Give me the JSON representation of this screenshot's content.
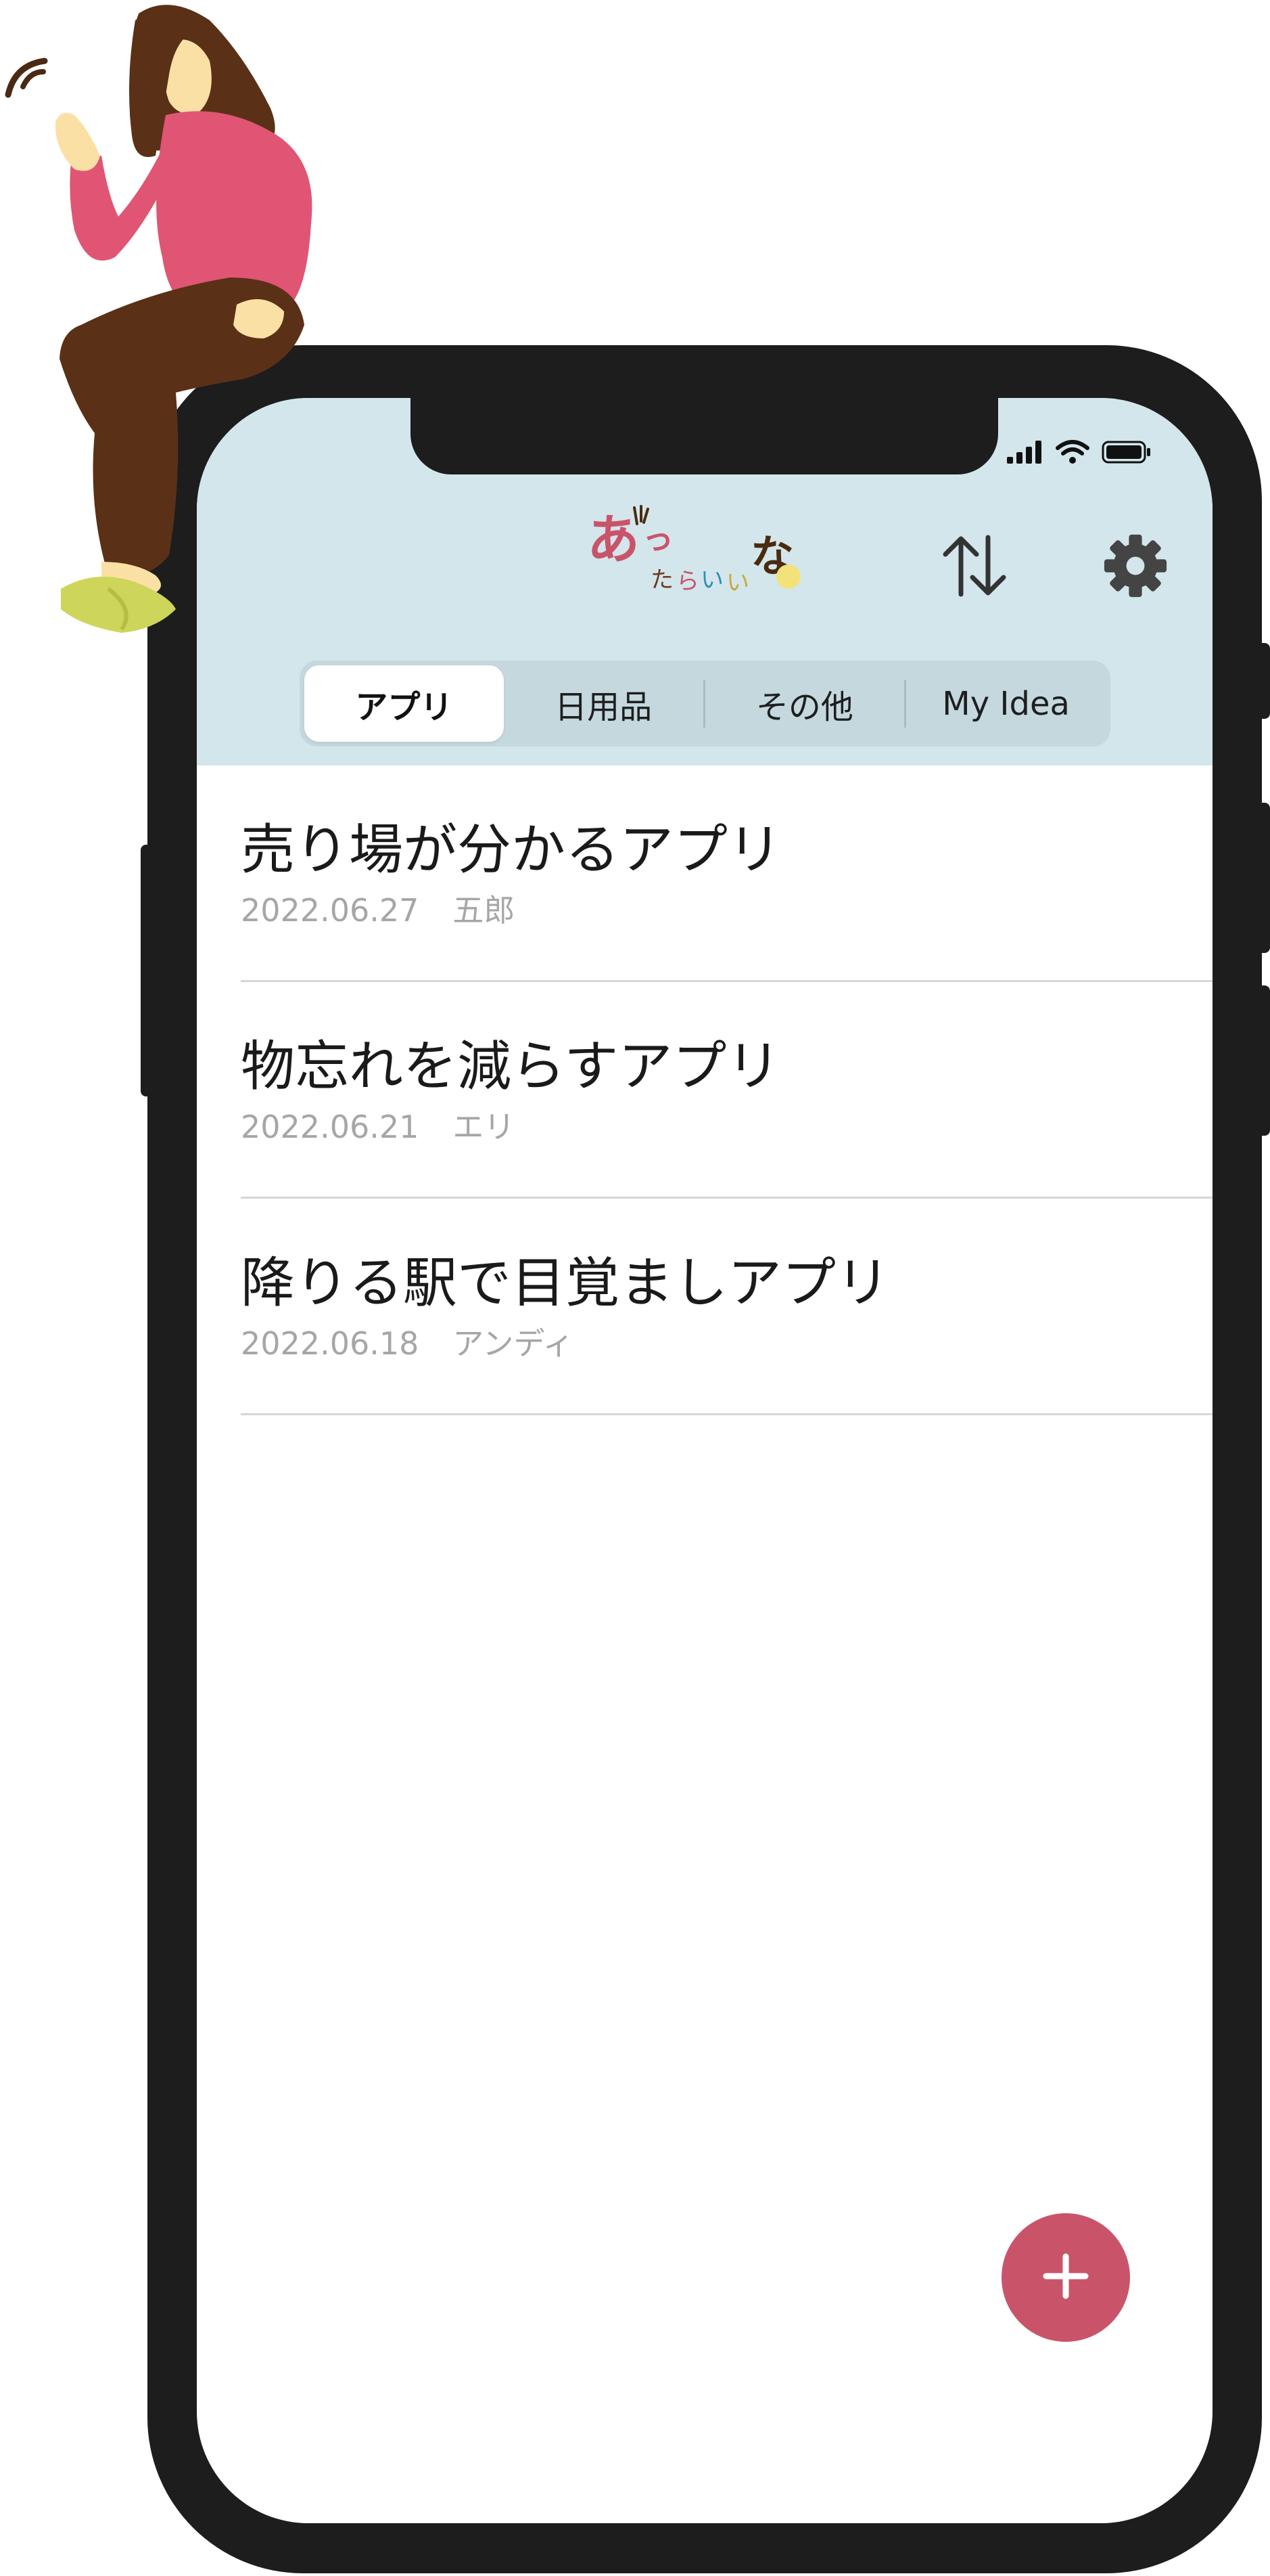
{
  "status_bar": {
    "icons": [
      "signal-icon",
      "wifi-icon",
      "battery-icon"
    ]
  },
  "header": {
    "logo_text": "あったらいいな",
    "sort_icon": "sort-arrows-icon",
    "settings_icon": "gear-icon"
  },
  "tabs": [
    {
      "label": "アプリ",
      "active": true
    },
    {
      "label": "日用品",
      "active": false
    },
    {
      "label": "その他",
      "active": false
    },
    {
      "label": "My Idea",
      "active": false
    }
  ],
  "ideas": [
    {
      "title": "売り場が分かるアプリ",
      "date": "2022.06.27",
      "author": "五郎"
    },
    {
      "title": "物忘れを減らすアプリ",
      "date": "2022.06.21",
      "author": "エリ"
    },
    {
      "title": "降りる駅で目覚ましアプリ",
      "date": "2022.06.18",
      "author": "アンディ"
    }
  ],
  "fab": {
    "icon": "plus-icon"
  },
  "colors": {
    "header_bg": "#d3e6ec",
    "tab_track": "#c4d8de",
    "accent": "#c9546a",
    "phone_frame": "#1d1d1d"
  }
}
